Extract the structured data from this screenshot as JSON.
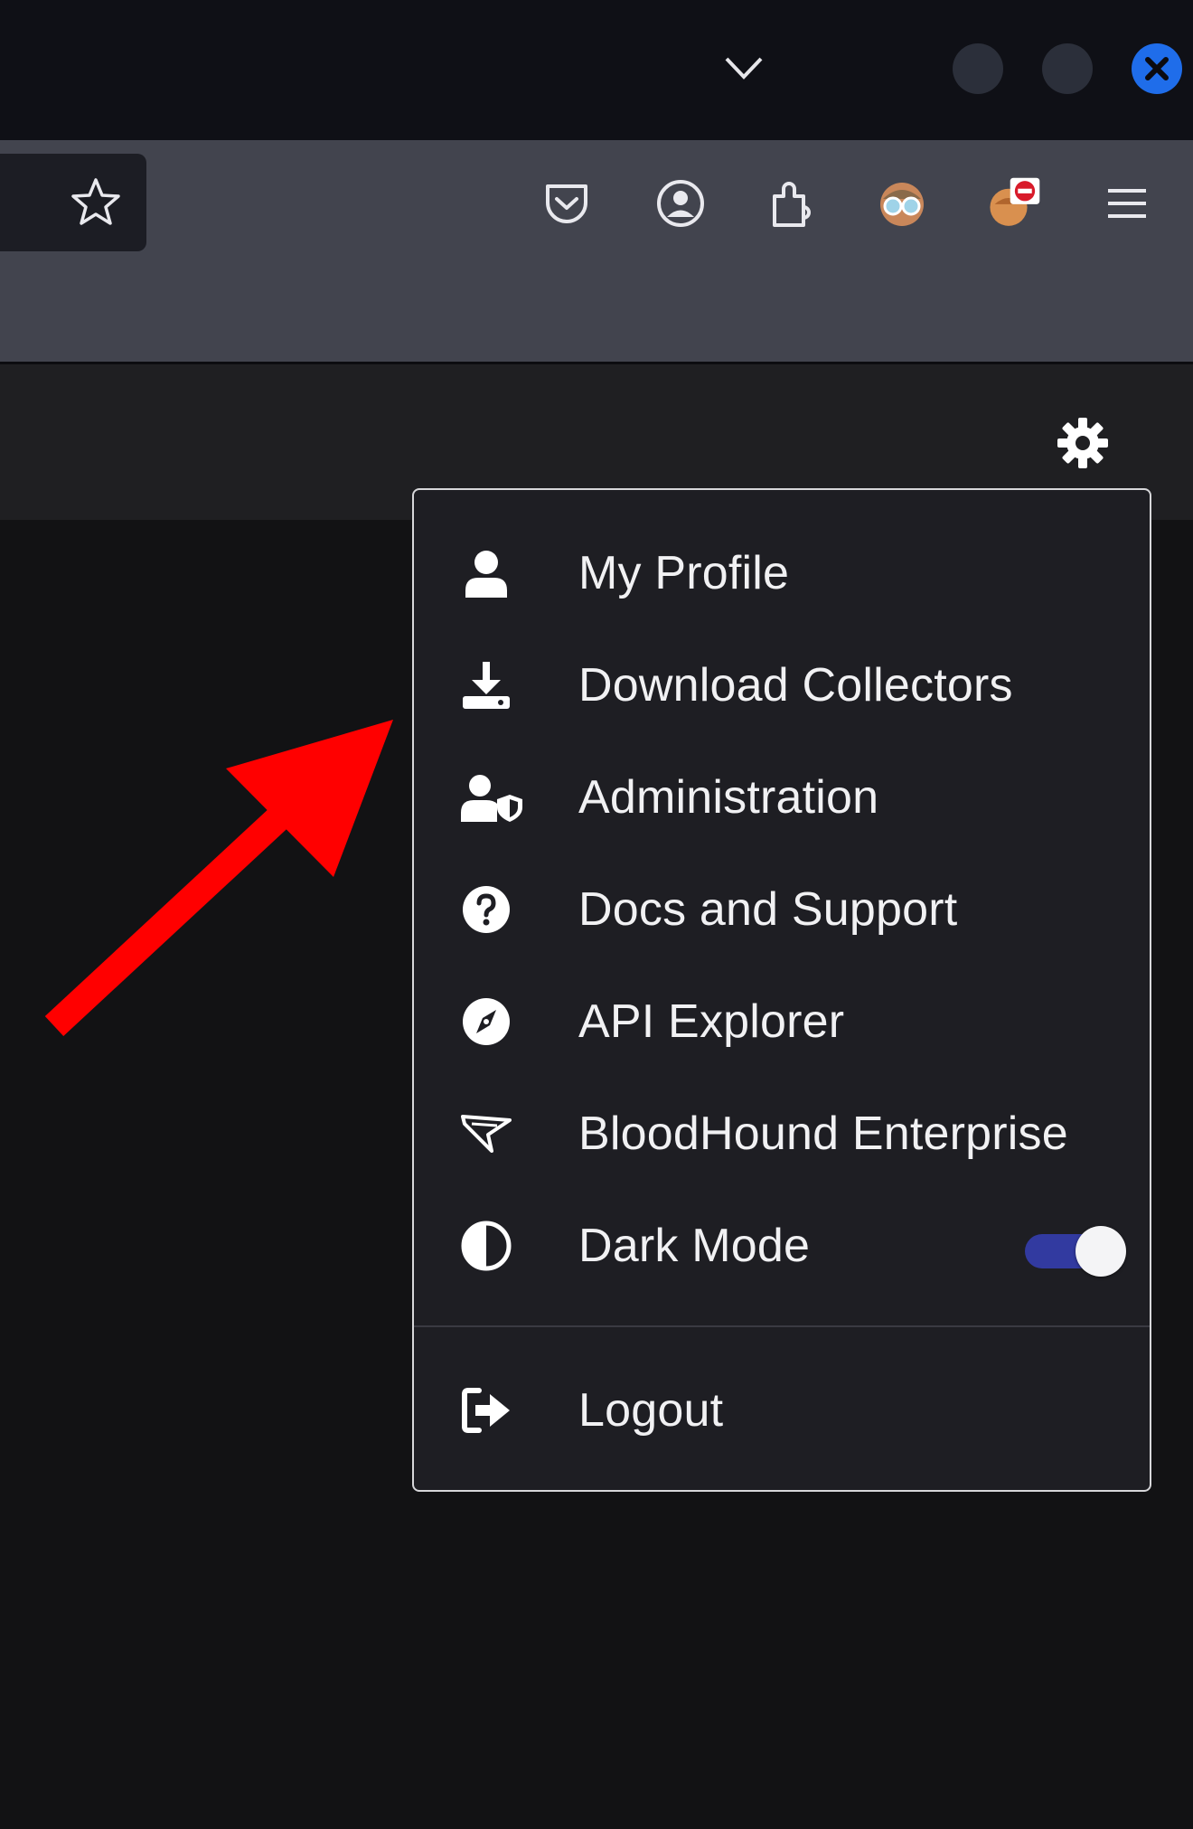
{
  "browser": {
    "window_controls": {
      "close_color": "#1f6dea"
    },
    "toolbar_icons": [
      "star-icon",
      "pocket-icon",
      "account-icon",
      "extensions-icon",
      "extension-avatar-icon",
      "extension-blocker-icon",
      "hamburger-menu-icon"
    ]
  },
  "menu": {
    "items": [
      {
        "label": "My Profile",
        "icon": "user-icon"
      },
      {
        "label": "Download Collectors",
        "icon": "download-icon"
      },
      {
        "label": "Administration",
        "icon": "user-shield-icon"
      },
      {
        "label": "Docs and Support",
        "icon": "question-circle-icon"
      },
      {
        "label": "API Explorer",
        "icon": "compass-icon"
      },
      {
        "label": "BloodHound Enterprise",
        "icon": "bloodhound-enterprise-icon"
      },
      {
        "label": "Dark Mode",
        "icon": "half-circle-icon",
        "toggle_on": true
      },
      {
        "label": "Logout",
        "icon": "logout-icon"
      }
    ]
  },
  "colors": {
    "accent": "#323aa0",
    "annotation_arrow": "#ff0000"
  }
}
